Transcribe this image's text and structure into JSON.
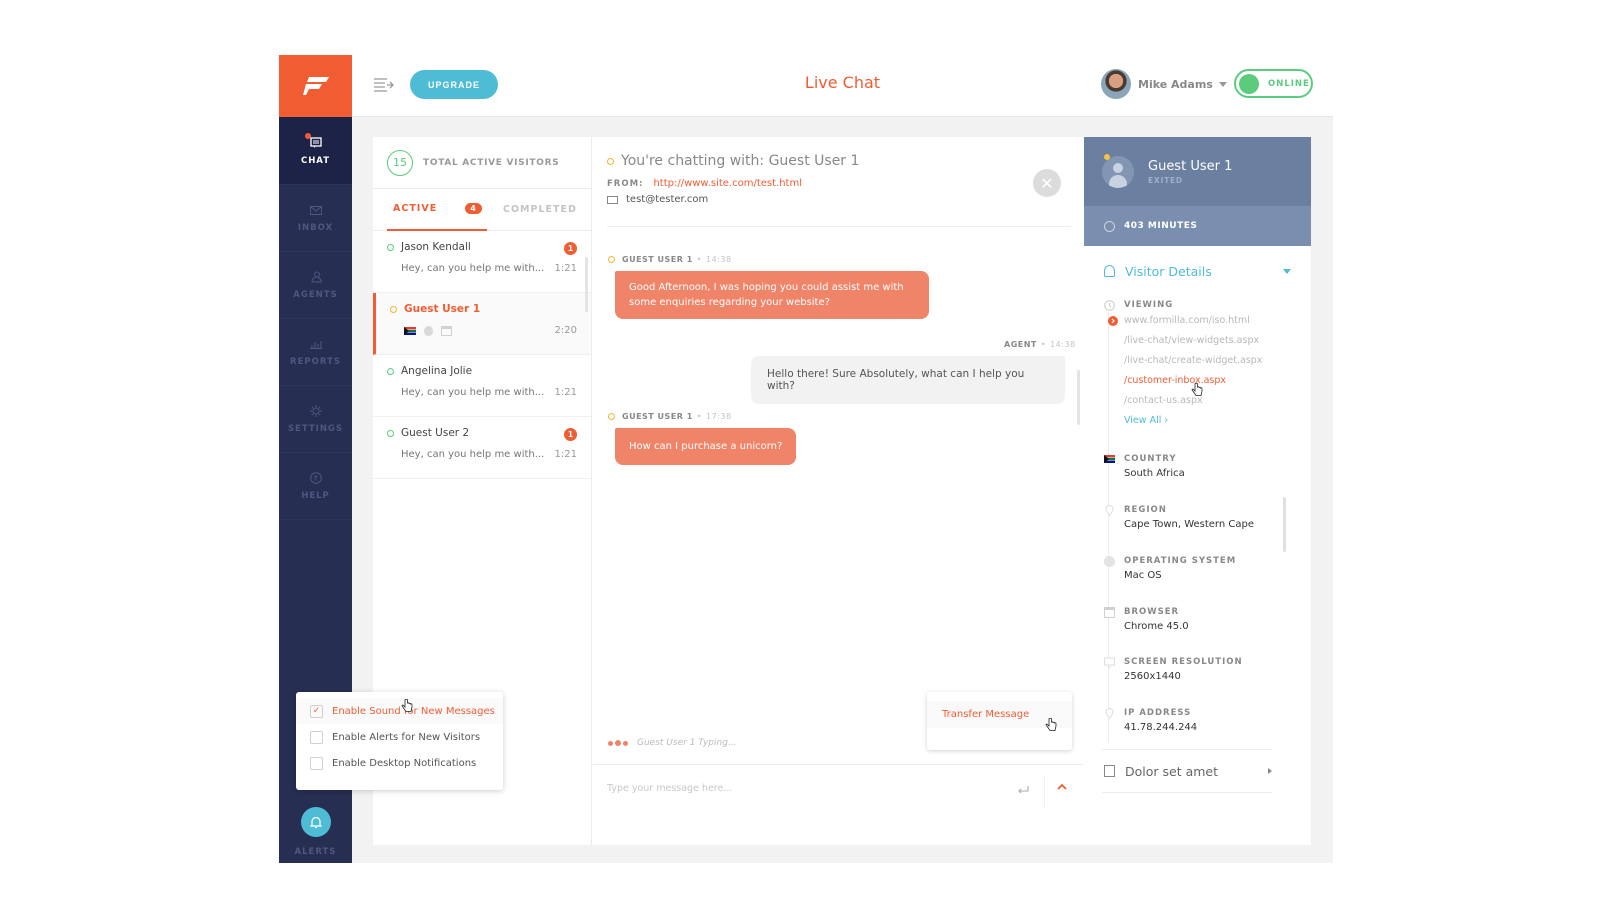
{
  "app": {
    "title": "Live Chat",
    "upgrade_label": "UPGRADE",
    "user": {
      "name": "Mike Adams",
      "status": "ONLINE"
    }
  },
  "colors": {
    "accent": "#f15d33",
    "online": "#5bcc7e",
    "info": "#4fbcd6",
    "sidebar": "#262e52",
    "guest_bubble": "#ef8469"
  },
  "sidebar": {
    "items": [
      {
        "label": "CHAT",
        "icon": "chat-icon",
        "active": true
      },
      {
        "label": "INBOX",
        "icon": "inbox-icon"
      },
      {
        "label": "AGENTS",
        "icon": "agents-icon"
      },
      {
        "label": "REPORTS",
        "icon": "reports-icon"
      },
      {
        "label": "SETTINGS",
        "icon": "gear-icon"
      },
      {
        "label": "HELP",
        "icon": "help-icon"
      }
    ],
    "alerts_label": "ALERTS"
  },
  "visitors": {
    "count": "15",
    "label": "TOTAL ACTIVE VISITORS",
    "tabs": {
      "active": "ACTIVE",
      "active_badge": "4",
      "completed": "COMPLETED"
    },
    "conversations": [
      {
        "name": "Jason Kendall",
        "preview": "Hey, can you help me with...",
        "time": "1:21",
        "unread": "1"
      },
      {
        "name": "Guest User 1",
        "preview": "",
        "time": "2:20",
        "unread": ""
      },
      {
        "name": "Angelina Jolie",
        "preview": "Hey, can you help me with...",
        "time": "1:21",
        "unread": ""
      },
      {
        "name": "Guest User 2",
        "preview": "Hey, can you help me with...",
        "time": "1:21",
        "unread": "1"
      }
    ]
  },
  "chat": {
    "title": "You're chatting with: Guest User 1",
    "from_label": "FROM:",
    "from_url": "http://www.site.com/test.html",
    "email": "test@tester.com",
    "messages": [
      {
        "sender": "GUEST USER 1",
        "time": "14:38",
        "text": "Good Afternoon, I was hoping you could assist me with some enquiries regarding your website?"
      },
      {
        "sender": "AGENT",
        "time": "14:38",
        "text": "Hello there! Sure Absolutely, what can I help you with?"
      },
      {
        "sender": "GUEST USER 1",
        "time": "17:38",
        "text": "How can I purchase a unicorn?"
      }
    ],
    "typing": "Guest User 1 Typing...",
    "transfer_label": "Transfer Message",
    "input_placeholder": "Type your message here..."
  },
  "details": {
    "guest_name": "Guest User 1",
    "guest_status": "EXITED",
    "duration": "403 MINUTES",
    "section_title": "Visitor Details",
    "viewing_label": "VIEWING",
    "pages": [
      "www.formilla.com/iso.html",
      "/live-chat/view-widgets.aspx",
      "/live-chat/create-widget.aspx",
      "/customer-inbox.aspx",
      "/contact-us.aspx"
    ],
    "view_all": "View All ›",
    "country_label": "COUNTRY",
    "country": "South Africa",
    "region_label": "REGION",
    "region": "Cape Town, Western Cape",
    "os_label": "OPERATING SYSTEM",
    "os": "Mac OS",
    "browser_label": "BROWSER",
    "browser": "Chrome 45.0",
    "resolution_label": "SCREEN RESOLUTION",
    "resolution": "2560x1440",
    "ip_label": "IP ADDRESS",
    "ip": "41.78.244.244",
    "extra_section": "Dolor set amet"
  },
  "alert_options": [
    {
      "label": "Enable Sound for New Messages",
      "checked": true
    },
    {
      "label": "Enable Alerts for New Visitors",
      "checked": false
    },
    {
      "label": "Enable Desktop Notifications",
      "checked": false
    }
  ]
}
